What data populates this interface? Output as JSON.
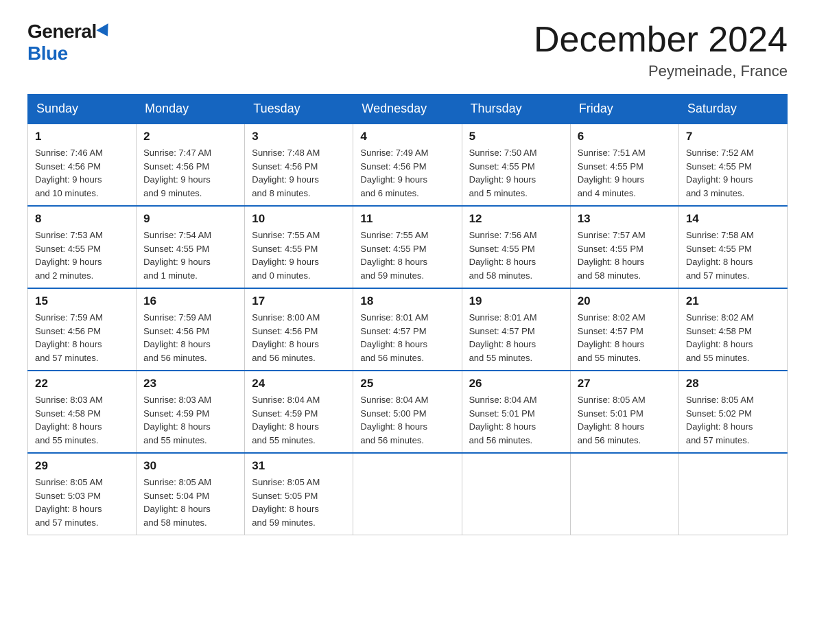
{
  "logo": {
    "general": "General",
    "blue": "Blue"
  },
  "title": {
    "month_year": "December 2024",
    "location": "Peymeinade, France"
  },
  "weekdays": [
    "Sunday",
    "Monday",
    "Tuesday",
    "Wednesday",
    "Thursday",
    "Friday",
    "Saturday"
  ],
  "weeks": [
    [
      {
        "day": "1",
        "sunrise": "7:46 AM",
        "sunset": "4:56 PM",
        "daylight": "9 hours and 10 minutes."
      },
      {
        "day": "2",
        "sunrise": "7:47 AM",
        "sunset": "4:56 PM",
        "daylight": "9 hours and 9 minutes."
      },
      {
        "day": "3",
        "sunrise": "7:48 AM",
        "sunset": "4:56 PM",
        "daylight": "9 hours and 8 minutes."
      },
      {
        "day": "4",
        "sunrise": "7:49 AM",
        "sunset": "4:56 PM",
        "daylight": "9 hours and 6 minutes."
      },
      {
        "day": "5",
        "sunrise": "7:50 AM",
        "sunset": "4:55 PM",
        "daylight": "9 hours and 5 minutes."
      },
      {
        "day": "6",
        "sunrise": "7:51 AM",
        "sunset": "4:55 PM",
        "daylight": "9 hours and 4 minutes."
      },
      {
        "day": "7",
        "sunrise": "7:52 AM",
        "sunset": "4:55 PM",
        "daylight": "9 hours and 3 minutes."
      }
    ],
    [
      {
        "day": "8",
        "sunrise": "7:53 AM",
        "sunset": "4:55 PM",
        "daylight": "9 hours and 2 minutes."
      },
      {
        "day": "9",
        "sunrise": "7:54 AM",
        "sunset": "4:55 PM",
        "daylight": "9 hours and 1 minute."
      },
      {
        "day": "10",
        "sunrise": "7:55 AM",
        "sunset": "4:55 PM",
        "daylight": "9 hours and 0 minutes."
      },
      {
        "day": "11",
        "sunrise": "7:55 AM",
        "sunset": "4:55 PM",
        "daylight": "8 hours and 59 minutes."
      },
      {
        "day": "12",
        "sunrise": "7:56 AM",
        "sunset": "4:55 PM",
        "daylight": "8 hours and 58 minutes."
      },
      {
        "day": "13",
        "sunrise": "7:57 AM",
        "sunset": "4:55 PM",
        "daylight": "8 hours and 58 minutes."
      },
      {
        "day": "14",
        "sunrise": "7:58 AM",
        "sunset": "4:55 PM",
        "daylight": "8 hours and 57 minutes."
      }
    ],
    [
      {
        "day": "15",
        "sunrise": "7:59 AM",
        "sunset": "4:56 PM",
        "daylight": "8 hours and 57 minutes."
      },
      {
        "day": "16",
        "sunrise": "7:59 AM",
        "sunset": "4:56 PM",
        "daylight": "8 hours and 56 minutes."
      },
      {
        "day": "17",
        "sunrise": "8:00 AM",
        "sunset": "4:56 PM",
        "daylight": "8 hours and 56 minutes."
      },
      {
        "day": "18",
        "sunrise": "8:01 AM",
        "sunset": "4:57 PM",
        "daylight": "8 hours and 56 minutes."
      },
      {
        "day": "19",
        "sunrise": "8:01 AM",
        "sunset": "4:57 PM",
        "daylight": "8 hours and 55 minutes."
      },
      {
        "day": "20",
        "sunrise": "8:02 AM",
        "sunset": "4:57 PM",
        "daylight": "8 hours and 55 minutes."
      },
      {
        "day": "21",
        "sunrise": "8:02 AM",
        "sunset": "4:58 PM",
        "daylight": "8 hours and 55 minutes."
      }
    ],
    [
      {
        "day": "22",
        "sunrise": "8:03 AM",
        "sunset": "4:58 PM",
        "daylight": "8 hours and 55 minutes."
      },
      {
        "day": "23",
        "sunrise": "8:03 AM",
        "sunset": "4:59 PM",
        "daylight": "8 hours and 55 minutes."
      },
      {
        "day": "24",
        "sunrise": "8:04 AM",
        "sunset": "4:59 PM",
        "daylight": "8 hours and 55 minutes."
      },
      {
        "day": "25",
        "sunrise": "8:04 AM",
        "sunset": "5:00 PM",
        "daylight": "8 hours and 56 minutes."
      },
      {
        "day": "26",
        "sunrise": "8:04 AM",
        "sunset": "5:01 PM",
        "daylight": "8 hours and 56 minutes."
      },
      {
        "day": "27",
        "sunrise": "8:05 AM",
        "sunset": "5:01 PM",
        "daylight": "8 hours and 56 minutes."
      },
      {
        "day": "28",
        "sunrise": "8:05 AM",
        "sunset": "5:02 PM",
        "daylight": "8 hours and 57 minutes."
      }
    ],
    [
      {
        "day": "29",
        "sunrise": "8:05 AM",
        "sunset": "5:03 PM",
        "daylight": "8 hours and 57 minutes."
      },
      {
        "day": "30",
        "sunrise": "8:05 AM",
        "sunset": "5:04 PM",
        "daylight": "8 hours and 58 minutes."
      },
      {
        "day": "31",
        "sunrise": "8:05 AM",
        "sunset": "5:05 PM",
        "daylight": "8 hours and 59 minutes."
      },
      null,
      null,
      null,
      null
    ]
  ],
  "labels": {
    "sunrise": "Sunrise: ",
    "sunset": "Sunset: ",
    "daylight": "Daylight: "
  }
}
